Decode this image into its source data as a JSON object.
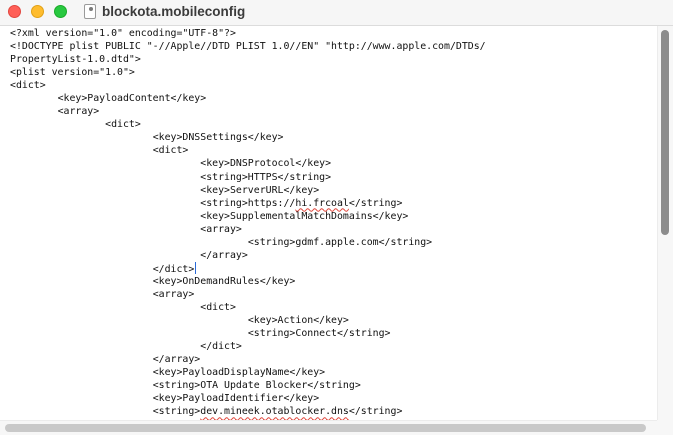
{
  "window": {
    "title": "blockota.mobileconfig",
    "document_icon": "document-icon",
    "colors": {
      "close": "#ff5f57",
      "minimize": "#febc2e",
      "zoom": "#28c840"
    }
  },
  "editor": {
    "caret_color": "#2a6ad8",
    "spellcheck_underline_color": "#e0453a",
    "lines": [
      [
        "<?xml version=\"1.0\" encoding=\"UTF-8\"?>"
      ],
      [
        "<!DOCTYPE plist PUBLIC \"-//Apple//DTD PLIST 1.0//EN\" \"http://www.apple.com/DTDs/"
      ],
      [
        "PropertyList-1.0.dtd\">"
      ],
      [
        "<plist version=\"1.0\">"
      ],
      [
        "<dict>"
      ],
      [
        "\t<key>PayloadContent</key>"
      ],
      [
        "\t<array>"
      ],
      [
        "\t\t<dict>"
      ],
      [
        "\t\t\t<key>DNSSettings</key>"
      ],
      [
        "\t\t\t<dict>"
      ],
      [
        "\t\t\t\t<key>DNSProtocol</key>"
      ],
      [
        "\t\t\t\t<string>HTTPS</string>"
      ],
      [
        "\t\t\t\t<key>ServerURL</key>"
      ],
      [
        "\t\t\t\t<string>https://",
        "hi.frcoal",
        "</string>"
      ],
      [
        "\t\t\t\t<key>SupplementalMatchDomains</key>"
      ],
      [
        "\t\t\t\t<array>"
      ],
      [
        "\t\t\t\t\t<string>gdmf.apple.com</string>"
      ],
      [
        "\t\t\t\t</array>"
      ],
      [
        "\t\t\t</dict>"
      ],
      [
        "\t\t\t<key>OnDemandRules</key>"
      ],
      [
        "\t\t\t<array>"
      ],
      [
        "\t\t\t\t<dict>"
      ],
      [
        "\t\t\t\t\t<key>Action</key>"
      ],
      [
        "\t\t\t\t\t<string>Connect</string>"
      ],
      [
        "\t\t\t\t</dict>"
      ],
      [
        "\t\t\t</array>"
      ],
      [
        "\t\t\t<key>PayloadDisplayName</key>"
      ],
      [
        "\t\t\t<string>OTA Update Blocker</string>"
      ],
      [
        "\t\t\t<key>PayloadIdentifier</key>"
      ],
      [
        "\t\t\t<string>",
        "dev.mineek.otablocker.dns",
        "</string>"
      ]
    ]
  }
}
